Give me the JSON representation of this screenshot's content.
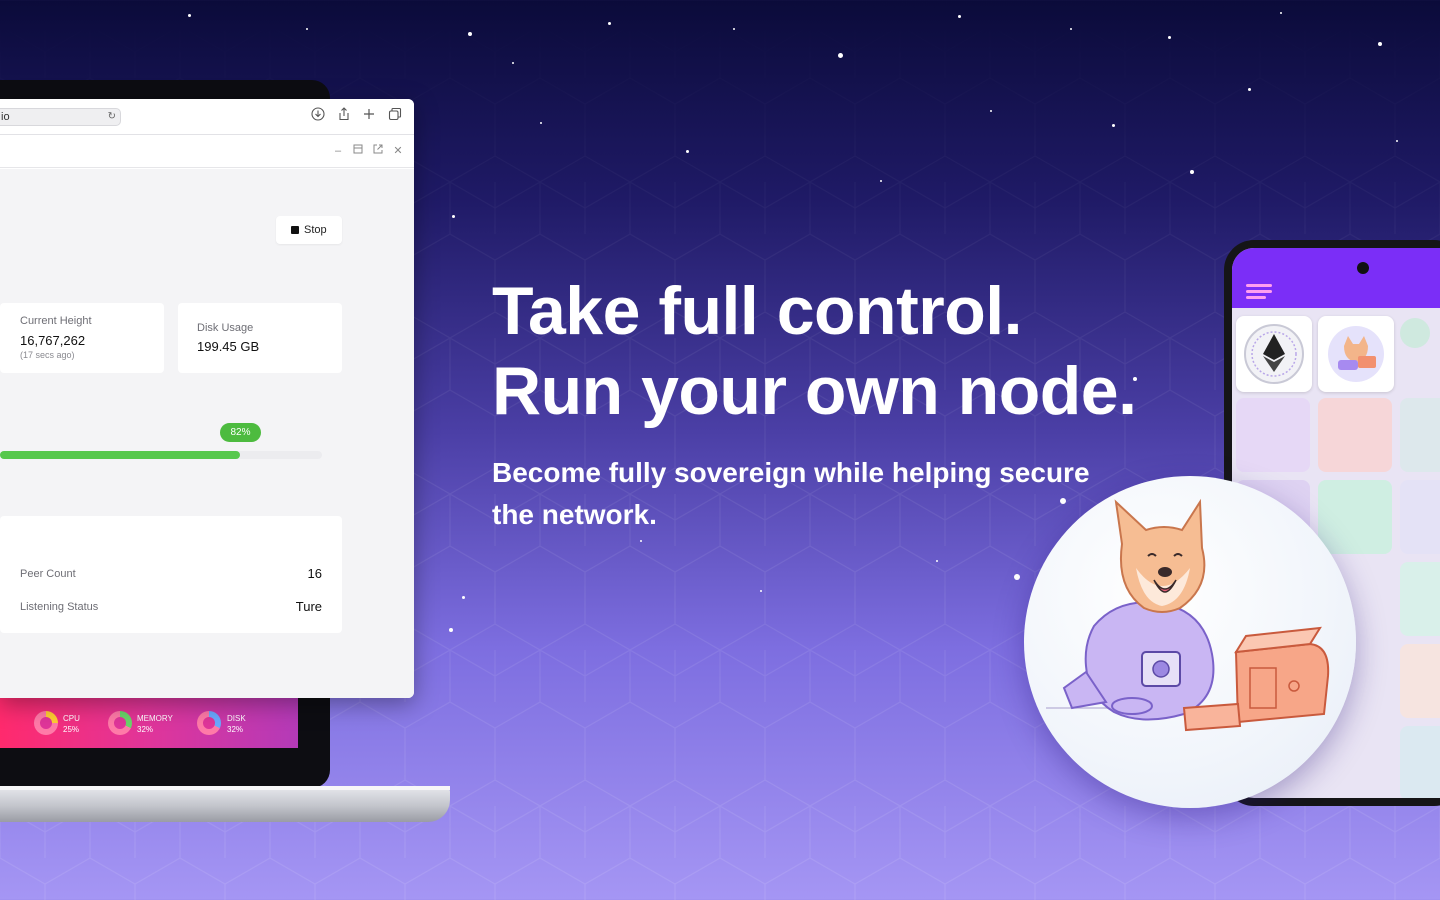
{
  "browser": {
    "url_text": "io",
    "reload_icon": "reload-icon",
    "toolbar_icons": [
      "download-icon",
      "share-icon",
      "plus-icon",
      "tabs-icon"
    ],
    "window_controls": [
      "minimize-icon",
      "restore-icon",
      "popout-icon",
      "close-icon"
    ]
  },
  "node": {
    "stop_label": "Stop",
    "current_height_label": "Current Height",
    "current_height_value": "16,767,262",
    "current_height_sub": "(17 secs ago)",
    "disk_usage_label": "Disk Usage",
    "disk_usage_value": "199.45 GB",
    "sync_percent_label": "82%",
    "sync_fraction": 0.82,
    "peer_count_label": "Peer Count",
    "peer_count_value": "16",
    "listening_status_label": "Listening Status",
    "listening_status_value": "Ture"
  },
  "taskbar": {
    "cpu_label": "CPU",
    "cpu_value": "25%",
    "memory_label": "MEMORY",
    "memory_value": "32%",
    "disk_label": "DISK",
    "disk_value": "32%"
  },
  "hero": {
    "headline_line1": "Take full control.",
    "headline_line2": "Run your own node.",
    "subheadline": "Become fully sovereign while helping secure the network."
  },
  "colors": {
    "accent_green": "#4dbb3f",
    "phone_header": "#7b2ef7",
    "taskbar_pink": "#ff2a6d"
  },
  "phone": {
    "menu_icon": "hamburger-icon",
    "nft_icons": [
      "ethereum-badge-icon",
      "shiba-node-icon"
    ]
  },
  "illustration": {
    "icon": "shiba-astronaut-icon"
  }
}
